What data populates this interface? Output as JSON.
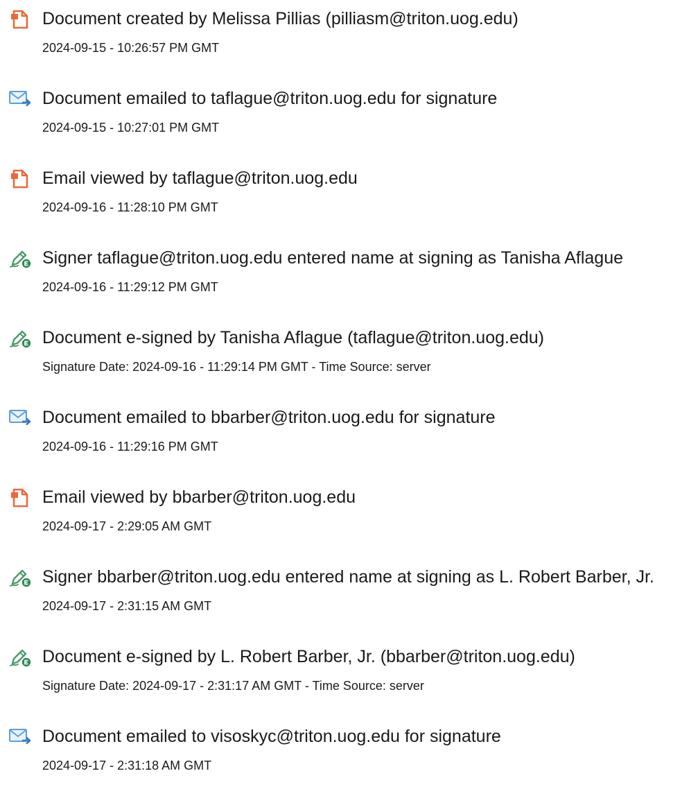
{
  "colors": {
    "document_icon": "#e8693b",
    "email_icon": "#5a9fd8",
    "email_arrow": "#3a78c0",
    "sign_icon": "#4a9a6a",
    "sign_badge": "#2e8b57",
    "text": "#1a1a1a"
  },
  "events": [
    {
      "icon": "document-icon",
      "title": "Document created by Melissa Pillias (pilliasm@triton.uog.edu)",
      "detail": "2024-09-15 - 10:26:57 PM GMT"
    },
    {
      "icon": "email-sent-icon",
      "title": "Document emailed to taflague@triton.uog.edu for signature",
      "detail": "2024-09-15 - 10:27:01 PM GMT"
    },
    {
      "icon": "document-icon",
      "title": "Email viewed by taflague@triton.uog.edu",
      "detail": "2024-09-16 - 11:28:10 PM GMT"
    },
    {
      "icon": "e-sign-pen-icon",
      "title": "Signer taflague@triton.uog.edu entered name at signing as Tanisha Aflague",
      "detail": "2024-09-16 - 11:29:12 PM GMT"
    },
    {
      "icon": "e-sign-pen-icon",
      "title": "Document e-signed by Tanisha Aflague (taflague@triton.uog.edu)",
      "detail": "Signature Date: 2024-09-16 - 11:29:14 PM GMT - Time Source: server"
    },
    {
      "icon": "email-sent-icon",
      "title": "Document emailed to bbarber@triton.uog.edu for signature",
      "detail": "2024-09-16 - 11:29:16 PM GMT"
    },
    {
      "icon": "document-icon",
      "title": "Email viewed by bbarber@triton.uog.edu",
      "detail": "2024-09-17 - 2:29:05 AM GMT"
    },
    {
      "icon": "e-sign-pen-icon",
      "title": "Signer bbarber@triton.uog.edu entered name at signing as L. Robert Barber, Jr.",
      "detail": "2024-09-17 - 2:31:15 AM GMT"
    },
    {
      "icon": "e-sign-pen-icon",
      "title": "Document e-signed by L. Robert Barber, Jr. (bbarber@triton.uog.edu)",
      "detail": "Signature Date: 2024-09-17 - 2:31:17 AM GMT - Time Source: server"
    },
    {
      "icon": "email-sent-icon",
      "title": "Document emailed to visoskyc@triton.uog.edu for signature",
      "detail": "2024-09-17 - 2:31:18 AM GMT"
    }
  ]
}
